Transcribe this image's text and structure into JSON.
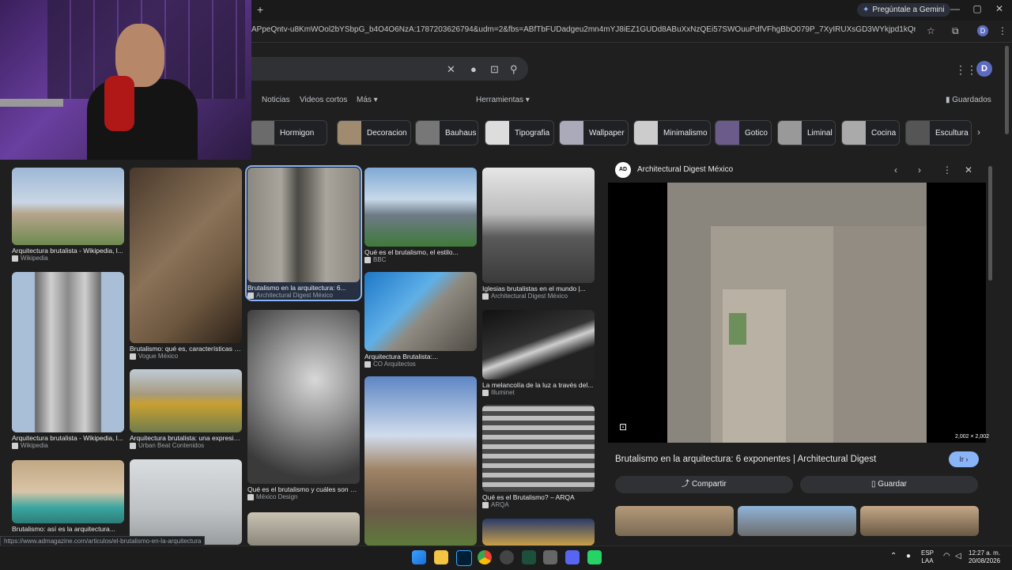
{
  "browser": {
    "new_tab": "+",
    "gemini_label": "Pregúntale a Gemini",
    "url": "APpeQntv-u8KmWOol2bYSbpG_b4O4O6NzA:1787203626794&udm=2&fbs=ABfTbFUDadgeu2mn4mYJ8iEZ1GUDd8ABuXxNzQEi57SWOuuPdfVFhgBbO079P_7XyIRUXsGD3WYkjpd1kQrnRhWpFJrtn9-1bAv_-3vuFh7eyZiY...",
    "minimize": "—",
    "maximize": "▢",
    "close": "✕",
    "profile_initial": "D"
  },
  "search": {
    "clear_icon": "✕",
    "mic_icon": "🎤",
    "lens_icon": "⊡",
    "search_icon": "⚲"
  },
  "account": {
    "initial": "D"
  },
  "nav_tabs": [
    "Noticias",
    "Videos cortos",
    "Más ▾"
  ],
  "tools_label": "Herramientas ▾",
  "saved_label": "Guardados",
  "chips": [
    {
      "label": "Hormigon",
      "color": "#6b6b6b"
    },
    {
      "label": "Decoracion",
      "color": "#a08a70"
    },
    {
      "label": "Bauhaus",
      "color": "#777"
    },
    {
      "label": "Tipografia",
      "color": "#ddd"
    },
    {
      "label": "Wallpaper",
      "color": "#aab"
    },
    {
      "label": "Minimalismo",
      "color": "#ccc"
    },
    {
      "label": "Gotico",
      "color": "#6b5b8b"
    },
    {
      "label": "Liminal",
      "color": "#999"
    },
    {
      "label": "Cocina",
      "color": "#aaa"
    },
    {
      "label": "Escultura",
      "color": "#555"
    }
  ],
  "cards": [
    {
      "title": "Arquitectura brutalista - Wikipedia, l...",
      "source": "Wikipedia"
    },
    {
      "title": "Arquitectura brutalista - Wikipedia, l...",
      "source": "Wikipedia"
    },
    {
      "title": "Brutalismo: así es la arquitectura...",
      "source": ""
    },
    {
      "title": "Brutalismo: qué es, características y...",
      "source": "Vogue México"
    },
    {
      "title": "Arquitectura brutalista: una expresió...",
      "source": "Urban Beat Contenidos"
    },
    {
      "title": "Brutalismo en la arquitectura: 6...",
      "source": "Architectural Digest México"
    },
    {
      "title": "Qué es el brutalismo y cuáles son sus...",
      "source": "México Design"
    },
    {
      "title": "Qué es el brutalismo, el estilo...",
      "source": "BBC"
    },
    {
      "title": "Arquitectura Brutalista:...",
      "source": "CO Arquitectos"
    },
    {
      "title": "Iglesias brutalistas en el mundo |...",
      "source": "Architectural Digest México"
    },
    {
      "title": "La melancolía de la luz a través del...",
      "source": "Illuminet"
    },
    {
      "title": "Qué es el Brutalismo? – ARQA",
      "source": "ARQA"
    }
  ],
  "panel": {
    "publisher_logo": "AD",
    "publisher": "Architectural Digest México",
    "prev_icon": "‹",
    "next_icon": "›",
    "more_icon": "⋮",
    "close_icon": "✕",
    "dimensions": "2,002 × 2,002",
    "title": "Brutalismo en la arquitectura: 6 exponentes | Architectural Digest",
    "go_label": "Ir ›",
    "share_label": "Compartir",
    "save_label": "Guardar"
  },
  "status_url": "https://www.admagazine.com/articulos/el-brutalismo-en-la-arquitectura",
  "taskbar": {
    "lang_1": "ESP",
    "lang_2": "LAA",
    "time": "12:27 a. m.",
    "date": "20/08/2026"
  }
}
